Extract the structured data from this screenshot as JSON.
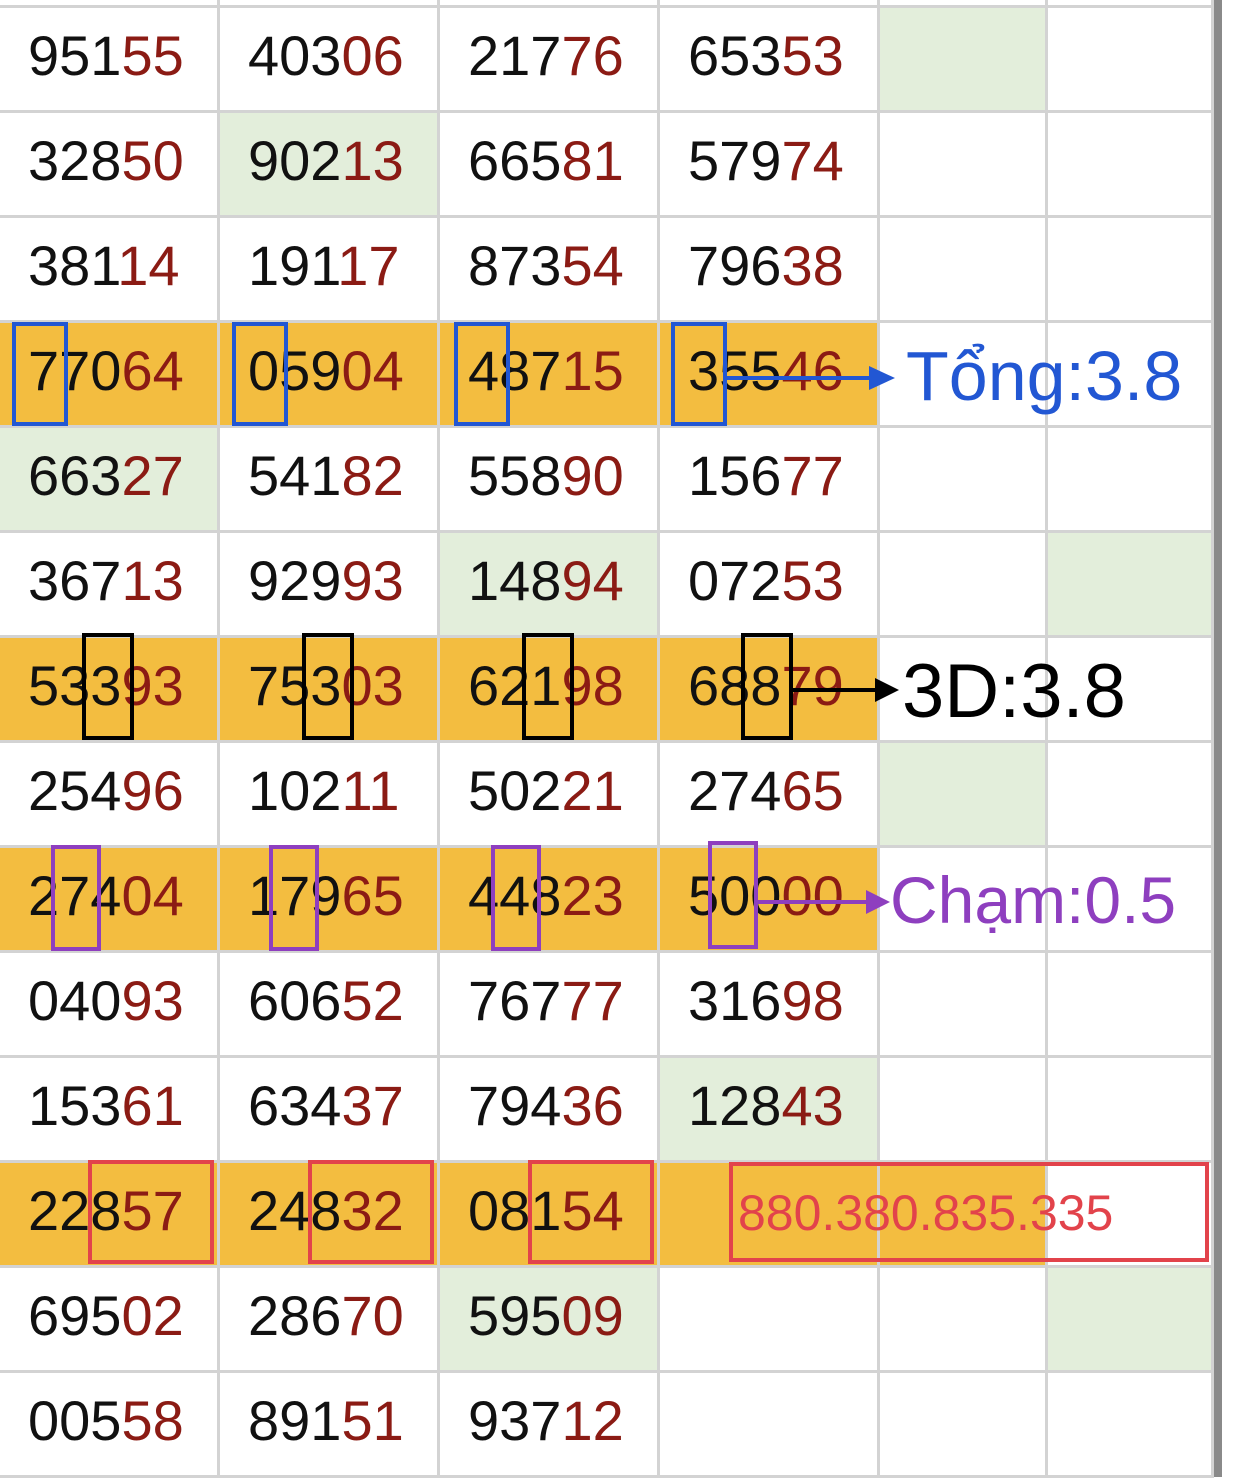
{
  "colors": {
    "head_digits": "#111111",
    "tail_digits": "#8b1b14",
    "highlight_row": "#f3bd40",
    "green_cell": "#e3eedb",
    "tong": "#2257d3",
    "threed": "#000000",
    "cham": "#8e3fbf",
    "result": "#e2434b"
  },
  "rows": [
    {
      "values": [
        "95155",
        "40306",
        "21776",
        "65353",
        "",
        ""
      ],
      "green": [
        4
      ]
    },
    {
      "values": [
        "32850",
        "90213",
        "66581",
        "57974",
        "",
        ""
      ],
      "green": [
        1
      ]
    },
    {
      "values": [
        "38114",
        "19117",
        "87354",
        "79638",
        "",
        ""
      ],
      "green": []
    },
    {
      "values": [
        "77064",
        "05904",
        "48715",
        "35546",
        "",
        ""
      ],
      "green": [],
      "highlight": true
    },
    {
      "values": [
        "66327",
        "54182",
        "55890",
        "15677",
        "",
        ""
      ],
      "green": [
        0
      ]
    },
    {
      "values": [
        "36713",
        "92993",
        "14894",
        "07253",
        "",
        ""
      ],
      "green": [
        2,
        5
      ]
    },
    {
      "values": [
        "53393",
        "75303",
        "62198",
        "68879",
        "",
        ""
      ],
      "green": [],
      "highlight": true
    },
    {
      "values": [
        "25496",
        "10211",
        "50221",
        "27465",
        "",
        ""
      ],
      "green": [
        4
      ]
    },
    {
      "values": [
        "27404",
        "17965",
        "44823",
        "50000",
        "",
        ""
      ],
      "green": [],
      "highlight": true
    },
    {
      "values": [
        "04093",
        "60652",
        "76777",
        "31698",
        "",
        ""
      ],
      "green": []
    },
    {
      "values": [
        "15361",
        "63437",
        "79436",
        "12843",
        "",
        ""
      ],
      "green": [
        3
      ]
    },
    {
      "values": [
        "22857",
        "24832",
        "08154",
        "",
        "",
        ""
      ],
      "green": [],
      "highlight": true
    },
    {
      "values": [
        "69502",
        "28670",
        "59509",
        "",
        "",
        ""
      ],
      "green": [
        2,
        5
      ]
    },
    {
      "values": [
        "00558",
        "89151",
        "93712",
        "",
        "",
        ""
      ],
      "green": []
    }
  ],
  "annotations": {
    "tong": "Tổng:3.8",
    "threed": "3D:3.8",
    "cham": "Chạm:0.5",
    "result": "880.380.835.335"
  }
}
